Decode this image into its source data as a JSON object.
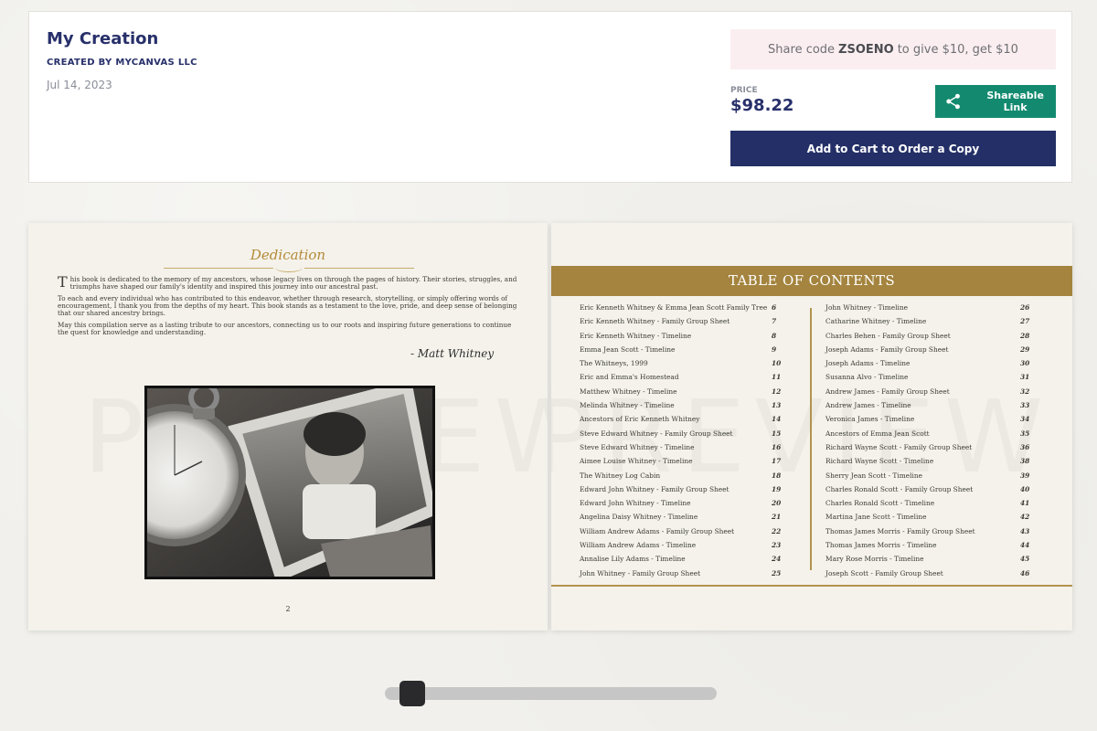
{
  "header": {
    "title": "My Creation",
    "creator": "CREATED BY MYCANVAS LLC",
    "date": "Jul 14, 2023",
    "share_code_prefix": "Share code",
    "share_code": "ZSOENO",
    "share_code_suffix": "to give $10, get $10",
    "price_label": "PRICE",
    "price": "$98.22",
    "share_link_label": "Shareable Link",
    "add_to_cart_label": "Add to Cart to Order a Copy",
    "colors": {
      "brand_navy": "#232f66",
      "share_green": "#138a6f",
      "share_code_bg": "#fbeef0",
      "gold": "#a4843e"
    }
  },
  "left_page": {
    "heading": "Dedication",
    "paragraphs": [
      "This book is dedicated to the memory of my ancestors, whose legacy lives on through the pages of history. Their stories, struggles, and triumphs have shaped our family's identity and inspired this journey into our ancestral past.",
      "To each and every individual who has contributed to this endeavor, whether through research, storytelling, or simply offering words of encouragement, I thank you from the depths of my heart. This book stands as a testament to the love, pride, and deep sense of belonging that our shared ancestry brings.",
      "May this compilation serve as a lasting tribute to our ancestors, connecting us to our roots and inspiring future generations to continue the quest for knowledge and understanding."
    ],
    "signature": "- Matt Whitney",
    "page_number": "2",
    "watermark": "PREVIEW"
  },
  "right_page": {
    "heading": "TABLE OF CONTENTS",
    "watermark": "PREVIEW",
    "left_column": [
      {
        "title": "Eric Kenneth Whitney & Emma Jean Scott Family Tree",
        "page": "6"
      },
      {
        "title": "Eric Kenneth Whitney - Family Group Sheet",
        "page": "7"
      },
      {
        "title": "Eric Kenneth Whitney - Timeline",
        "page": "8"
      },
      {
        "title": "Emma Jean Scott - Timeline",
        "page": "9"
      },
      {
        "title": "The Whitneys, 1999",
        "page": "10"
      },
      {
        "title": "Eric and Emma's Homestead",
        "page": "11"
      },
      {
        "title": "Matthew Whitney - Timeline",
        "page": "12"
      },
      {
        "title": "Melinda Whitney - Timeline",
        "page": "13"
      },
      {
        "title": "Ancestors of Eric Kenneth Whitney",
        "page": "14"
      },
      {
        "title": "Steve Edward Whitney - Family Group Sheet",
        "page": "15"
      },
      {
        "title": "Steve Edward Whitney - Timeline",
        "page": "16"
      },
      {
        "title": "Aimee Louise Whitney - Timeline",
        "page": "17"
      },
      {
        "title": "The Whitney Log Cabin",
        "page": "18"
      },
      {
        "title": "Edward John Whitney - Family Group Sheet",
        "page": "19"
      },
      {
        "title": "Edward John Whitney - Timeline",
        "page": "20"
      },
      {
        "title": "Angelina Daisy Whitney - Timeline",
        "page": "21"
      },
      {
        "title": "William Andrew Adams - Family Group Sheet",
        "page": "22"
      },
      {
        "title": "William Andrew Adams - Timeline",
        "page": "23"
      },
      {
        "title": "Annalise Lily Adams - Timeline",
        "page": "24"
      },
      {
        "title": "John Whitney - Family Group Sheet",
        "page": "25"
      }
    ],
    "right_column": [
      {
        "title": "John Whitney - Timeline",
        "page": "26"
      },
      {
        "title": "Catharine Whitney - Timeline",
        "page": "27"
      },
      {
        "title": "Charles Behen - Family Group Sheet",
        "page": "28"
      },
      {
        "title": "Joseph Adams - Family Group Sheet",
        "page": "29"
      },
      {
        "title": "Joseph Adams - Timeline",
        "page": "30"
      },
      {
        "title": "Susanna Alvo - Timeline",
        "page": "31"
      },
      {
        "title": "Andrew James - Family Group Sheet",
        "page": "32"
      },
      {
        "title": "Andrew James - Timeline",
        "page": "33"
      },
      {
        "title": "Veronica James - Timeline",
        "page": "34"
      },
      {
        "title": "Ancestors of Emma Jean Scott",
        "page": "35"
      },
      {
        "title": "Richard Wayne Scott - Family Group Sheet",
        "page": "36"
      },
      {
        "title": "Richard Wayne Scott - Timeline",
        "page": "38"
      },
      {
        "title": "Sherry Jean Scott - Timeline",
        "page": "39"
      },
      {
        "title": "Charles Ronald Scott - Family Group Sheet",
        "page": "40"
      },
      {
        "title": "Charles Ronald Scott - Timeline",
        "page": "41"
      },
      {
        "title": "Martina Jane Scott - Timeline",
        "page": "42"
      },
      {
        "title": "Thomas James Morris - Family Group Sheet",
        "page": "43"
      },
      {
        "title": "Thomas James Morris - Timeline",
        "page": "44"
      },
      {
        "title": "Mary Rose Morris - Timeline",
        "page": "45"
      },
      {
        "title": "Joseph Scott - Family Group Sheet",
        "page": "46"
      }
    ]
  },
  "page_slider": {
    "position_fraction": 0.05
  }
}
